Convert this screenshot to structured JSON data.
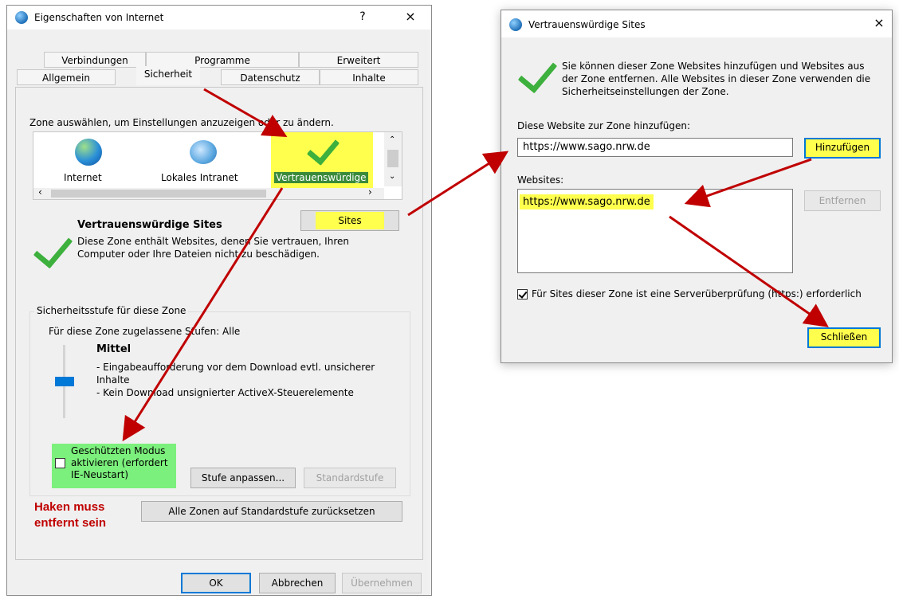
{
  "win1": {
    "title": "Eigenschaften von Internet",
    "help": "?",
    "close": "×",
    "tabs_row1": [
      "Verbindungen",
      "Programme",
      "Erweitert"
    ],
    "tabs_row2": [
      "Allgemein",
      "Sicherheit",
      "Datenschutz",
      "Inhalte"
    ],
    "zone_prompt": "Zone auswählen, um Einstellungen anzuzeigen oder zu ändern.",
    "zones": [
      "Internet",
      "Lokales Intranet",
      "Vertrauenswürdige"
    ],
    "sites_button": "Sites",
    "zone_title": "Vertrauenswürdige Sites",
    "zone_desc_1": "Diese Zone enthält Websites, denen Sie vertrauen, Ihren",
    "zone_desc_2": "Computer oder Ihre Dateien nicht zu beschädigen.",
    "security_group_label": "Sicherheitsstufe für diese Zone",
    "allowed_levels": "Für diese Zone zugelassene Stufen: Alle",
    "level_name": "Mittel",
    "level_desc_1": "- Eingabeaufforderung vor dem Download evtl. unsicherer",
    "level_desc_2": "Inhalte",
    "level_desc_3": "- Kein Download unsignierter ActiveX-Steuerelemente",
    "protected_mode_1": "Geschützten Modus",
    "protected_mode_2": "aktivieren (erfordert",
    "protected_mode_3": "IE-Neustart)",
    "custom_level_button": "Stufe anpassen...",
    "default_level_button": "Standardstufe",
    "note_1": "Haken muss",
    "note_2": "entfernt sein",
    "reset_all_button": "Alle Zonen auf Standardstufe zurücksetzen",
    "ok_button": "OK",
    "cancel_button": "Abbrechen",
    "apply_button": "Übernehmen"
  },
  "win2": {
    "title": "Vertrauenswürdige Sites",
    "close": "×",
    "info_1": "Sie können dieser Zone Websites hinzufügen und Websites aus",
    "info_2": "der Zone entfernen. Alle Websites in dieser Zone verwenden die",
    "info_3": "Sicherheitseinstellungen der Zone.",
    "add_label": "Diese Website zur Zone hinzufügen:",
    "add_value": "https://www.sago.nrw.de",
    "add_button": "Hinzufügen",
    "websites_label": "Websites:",
    "websites": [
      "https://www.sago.nrw.de"
    ],
    "remove_button": "Entfernen",
    "https_check": "Für Sites dieser Zone ist eine Serverüberprüfung (https:) erforderlich",
    "close_button": "Schließen"
  },
  "colors": {
    "highlight_yellow": "#ffff4d",
    "highlight_green": "#7cf07c",
    "annotation_red": "#c00000",
    "accent_blue": "#0078d7"
  }
}
